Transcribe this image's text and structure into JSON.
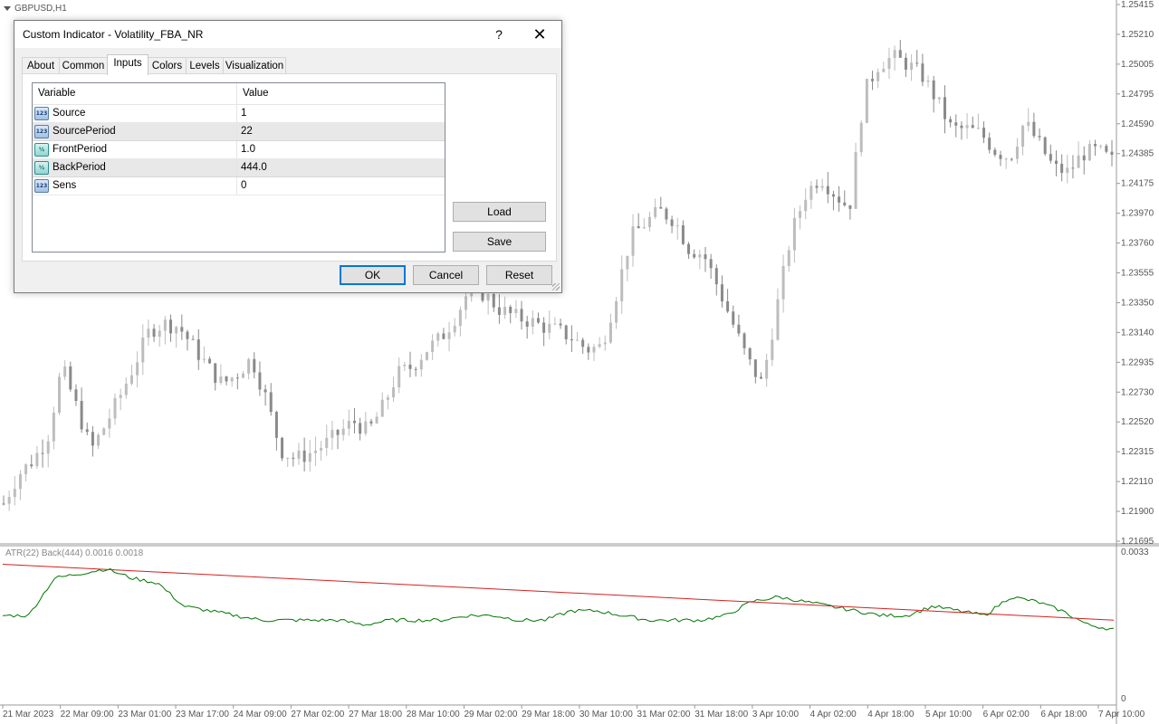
{
  "chart": {
    "symbol": "GBPUSD,H1",
    "indicator_label": "ATR(22) Back(444) 0.0016 0.0018",
    "price_axis_labels": [
      "1.25415",
      "1.25210",
      "1.25005",
      "1.24795",
      "1.24590",
      "1.24385",
      "1.24175",
      "1.23970",
      "1.23760",
      "1.23555",
      "1.23350",
      "1.23140",
      "1.22935",
      "1.22730",
      "1.22520",
      "1.22315",
      "1.22110",
      "1.21900",
      "1.21695"
    ],
    "indicator_axis_labels": [
      "0.0033",
      "0"
    ],
    "time_axis_labels": [
      "21 Mar 2023",
      "22 Mar 09:00",
      "23 Mar 01:00",
      "23 Mar 17:00",
      "24 Mar 09:00",
      "27 Mar 02:00",
      "27 Mar 18:00",
      "28 Mar 10:00",
      "29 Mar 02:00",
      "29 Mar 18:00",
      "30 Mar 10:00",
      "31 Mar 02:00",
      "31 Mar 18:00",
      "3 Apr 10:00",
      "4 Apr 02:00",
      "4 Apr 18:00",
      "5 Apr 10:00",
      "6 Apr 02:00",
      "6 Apr 18:00",
      "7 Apr 10:00"
    ],
    "colors": {
      "candle_bull": "#bdbdbd",
      "candle_bear": "#8a8a8a",
      "atr_line": "#007700",
      "back_line": "#d42020",
      "axis_text": "#555555"
    }
  },
  "chart_data": {
    "type": "line",
    "series": [
      {
        "values": [
          1.2195,
          1.2215,
          1.2225,
          1.224,
          1.229,
          1.2262,
          1.2232,
          1.225,
          1.227,
          1.2292,
          1.2315,
          1.232,
          1.2318,
          1.2304,
          1.229,
          1.2278,
          1.2285,
          1.2296,
          1.2268,
          1.2232,
          1.2226,
          1.223,
          1.2236,
          1.2244,
          1.2252,
          1.2245,
          1.2262,
          1.2285,
          1.229,
          1.2302,
          1.231,
          1.2325,
          1.2345,
          1.234,
          1.233,
          1.2325,
          1.2322,
          1.2318,
          1.2315,
          1.231,
          1.2302,
          1.2304,
          1.234,
          1.238,
          1.239,
          1.2398,
          1.2392,
          1.2372,
          1.2368,
          1.2345,
          1.232,
          1.2295,
          1.2278,
          1.233,
          1.2382,
          1.241,
          1.2422,
          1.241,
          1.24,
          1.248,
          1.25,
          1.2505,
          1.25,
          1.2492,
          1.2475,
          1.2455,
          1.2455,
          1.2452,
          1.244,
          1.2435,
          1.246,
          1.2445,
          1.2428,
          1.2425,
          1.2438,
          1.244,
          1.2433
        ]
      },
      {
        "values": [
          0.0019,
          0.0019,
          0.0027,
          0.0028,
          0.0029,
          0.0027,
          0.0026,
          0.0021,
          0.002,
          0.0019,
          0.0018,
          0.0018,
          0.0018,
          0.0018,
          0.0017,
          0.0018,
          0.0018,
          0.0018,
          0.0019,
          0.0019,
          0.0018,
          0.0018,
          0.002,
          0.002,
          0.0019,
          0.0018,
          0.0018,
          0.0018,
          0.0019,
          0.0022,
          0.0023,
          0.0022,
          0.0021,
          0.002,
          0.0019,
          0.0019,
          0.0021,
          0.002,
          0.0019,
          0.0023,
          0.0022,
          0.002,
          0.0017,
          0.0016
        ]
      },
      {
        "values": [
          0.003,
          0.0018
        ]
      }
    ]
  },
  "dialog": {
    "title": "Custom Indicator - Volatility_FBA_NR",
    "help": "?",
    "close": "✕",
    "tabs": [
      "About",
      "Common",
      "Inputs",
      "Colors",
      "Levels",
      "Visualization"
    ],
    "active_tab": "Inputs",
    "grid": {
      "col_variable": "Variable",
      "col_value": "Value",
      "rows": [
        {
          "icon": "123",
          "name": "Source",
          "value": "1"
        },
        {
          "icon": "123",
          "name": "SourcePeriod",
          "value": "22"
        },
        {
          "icon": "½",
          "name": "FrontPeriod",
          "value": "1.0"
        },
        {
          "icon": "½",
          "name": "BackPeriod",
          "value": "444.0"
        },
        {
          "icon": "123",
          "name": "Sens",
          "value": "0"
        }
      ]
    },
    "load_label": "Load",
    "save_label": "Save",
    "ok_label": "OK",
    "cancel_label": "Cancel",
    "reset_label": "Reset"
  }
}
